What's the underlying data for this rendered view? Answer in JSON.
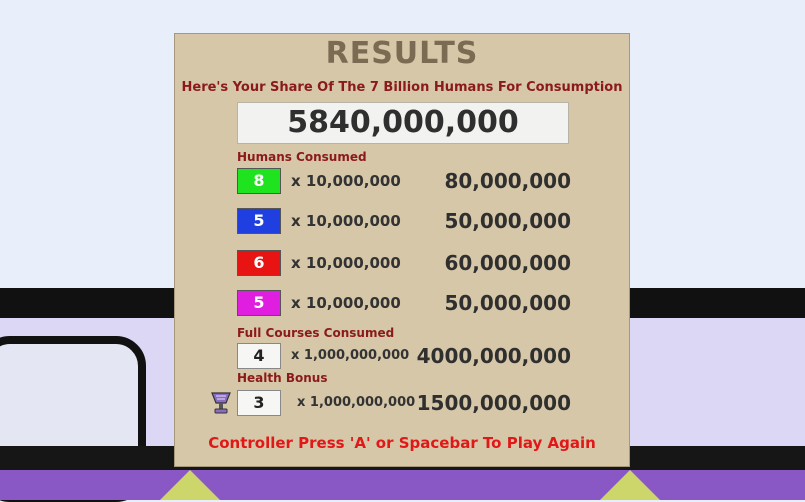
{
  "results": {
    "title": "RESULTS",
    "subtitle": "Here's Your Share Of The 7 Billion Humans For Consumption",
    "total": "5840,000,000",
    "humans_label": "Humans Consumed",
    "humans_rows": [
      {
        "count": "8",
        "color": "#1ee31e",
        "multiplier": "x 10,000,000",
        "value": "80,000,000"
      },
      {
        "count": "5",
        "color": "#1f3fe0",
        "multiplier": "x 10,000,000",
        "value": "50,000,000"
      },
      {
        "count": "6",
        "color": "#e81414",
        "multiplier": "x 10,000,000",
        "value": "60,000,000"
      },
      {
        "count": "5",
        "color": "#e01ee0",
        "multiplier": "x 10,000,000",
        "value": "50,000,000"
      }
    ],
    "courses_label": "Full Courses Consumed",
    "courses_row": {
      "count": "4",
      "multiplier": "x 1,000,000,000",
      "value": "4000,000,000"
    },
    "health_label": "Health Bonus",
    "health_icon": "trophy-icon",
    "health_row": {
      "count": "3",
      "multiplier": "x 1,000,000,000",
      "value": "1500,000,000"
    },
    "footer": "Controller Press 'A' or Spacebar To Play Again"
  }
}
